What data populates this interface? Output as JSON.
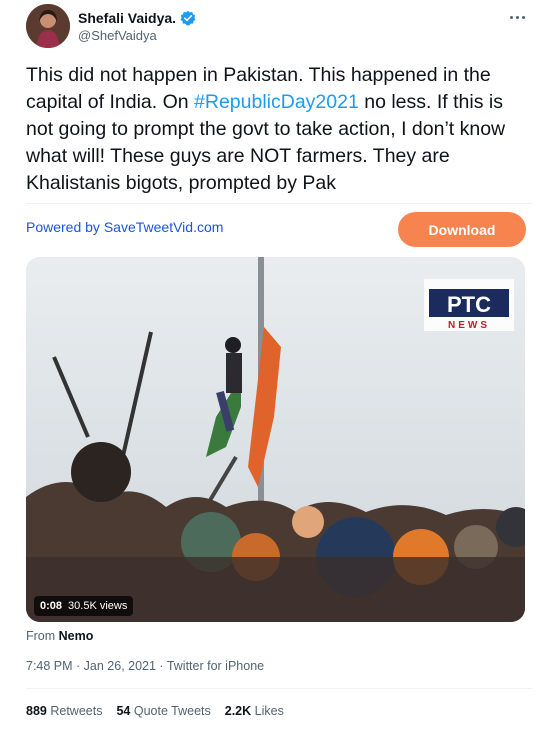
{
  "author": {
    "display_name": "Shefali Vaidya.",
    "handle": "@ShefVaidya",
    "verified": true
  },
  "tweet": {
    "text_before": "This did not happen in Pakistan. This happened in the capital of India. On ",
    "hashtag": "#RepublicDay2021",
    "text_after": " no less. If this is not going to prompt the govt to take action, I don’t know what will! These guys are NOT farmers. They are Khalistanis bigots, prompted by Pak"
  },
  "plugin": {
    "powered_by": "Powered by SaveTweetVid.com",
    "download_label": "Download"
  },
  "media": {
    "type": "video",
    "duration": "0:08",
    "views": "30.5K views",
    "watermark_line1": "PTC",
    "watermark_line2": "NEWS"
  },
  "source": {
    "prefix": "From ",
    "app": "Nemo"
  },
  "meta": {
    "time": "7:48 PM · Jan 26, 2021 · Twitter for iPhone"
  },
  "stats": {
    "retweets_count": "889",
    "retweets_label": "Retweets",
    "quotes_count": "54",
    "quotes_label": "Quote Tweets",
    "likes_count": "2.2K",
    "likes_label": "Likes"
  },
  "colors": {
    "accent": "#1d9bf0",
    "download": "#f7834f"
  }
}
